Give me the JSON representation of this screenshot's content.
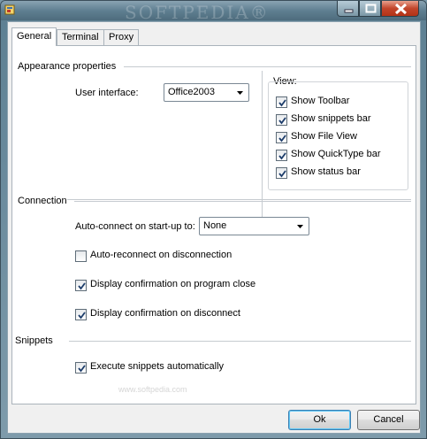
{
  "window": {
    "watermark": "SOFTPEDIA®",
    "minimize_glyph": "—",
    "maximize_glyph": "□",
    "close_glyph": "✕"
  },
  "tabs": [
    {
      "label": "General",
      "active": true
    },
    {
      "label": "Terminal",
      "active": false
    },
    {
      "label": "Proxy",
      "active": false
    }
  ],
  "appearance": {
    "title": "Appearance properties",
    "ui_label": "User interface:",
    "ui_value": "Office2003",
    "view": {
      "title": "View:",
      "items": [
        {
          "label": "Show Toolbar",
          "checked": true
        },
        {
          "label": "Show snippets bar",
          "checked": true
        },
        {
          "label": "Show File View",
          "checked": true
        },
        {
          "label": "Show QuickType bar",
          "checked": true
        },
        {
          "label": "Show status bar",
          "checked": true
        }
      ]
    }
  },
  "connection": {
    "title": "Connection",
    "auto_connect_label": "Auto-connect on start-up to:",
    "auto_connect_value": "None",
    "options": [
      {
        "label": "Auto-reconnect on disconnection",
        "checked": false
      },
      {
        "label": "Display confirmation on program close",
        "checked": true
      },
      {
        "label": "Display confirmation on disconnect",
        "checked": true
      }
    ]
  },
  "snippets": {
    "title": "Snippets",
    "options": [
      {
        "label": "Execute snippets automatically",
        "checked": true
      }
    ],
    "watermark": "www.softpedia.com"
  },
  "buttons": {
    "ok": "Ok",
    "cancel": "Cancel"
  },
  "colors": {
    "titlebar": "#5f7f91",
    "close_button": "#c2452b",
    "default_button_border": "#3c7fb1"
  }
}
